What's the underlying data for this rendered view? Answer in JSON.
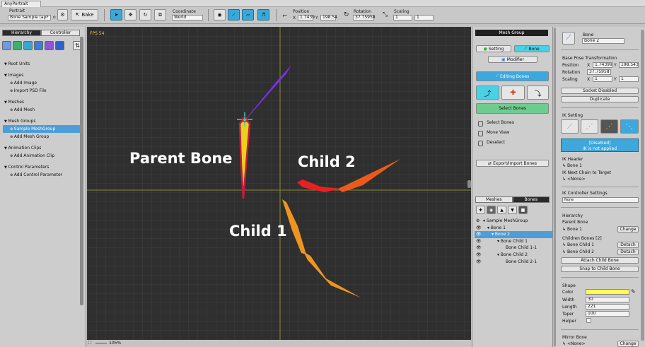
{
  "window": {
    "tab_title": "AnyPortrait"
  },
  "toolbar": {
    "portrait_label": "Portrait",
    "portrait_value": "Bone Sample (apF",
    "bake_label": "Bake",
    "coordinate_label": "Coordinate",
    "coordinate_value": "World",
    "position_label": "Position",
    "position_x": "1.7439",
    "position_y": "198.54",
    "rotation_label": "Rotation",
    "rotation_value": "37.75958",
    "scaling_label": "Scaling",
    "scaling_x": "1",
    "scaling_y": "1",
    "x_label": "X",
    "y_label": "Y"
  },
  "left_panel": {
    "tab_hierarchy": "Hierarchy",
    "tab_controller": "Controller",
    "sections": [
      {
        "header": "Root Units",
        "items": []
      },
      {
        "header": "Images",
        "items": [
          "Add Image",
          "Import PSD File"
        ]
      },
      {
        "header": "Meshes",
        "items": [
          "Add Mesh"
        ]
      },
      {
        "header": "Mesh Groups",
        "items": [
          "Sample MeshGroup",
          "Add Mesh Group"
        ]
      },
      {
        "header": "Animation Clips",
        "items": [
          "Add Animation Clip"
        ]
      },
      {
        "header": "Control Parameters",
        "items": [
          "Add Control Parameter"
        ]
      }
    ],
    "selected_item": "Sample MeshGroup"
  },
  "viewport": {
    "fps": "FPS 54",
    "zoom": "105%",
    "labels": {
      "parent_bone": "Parent Bone",
      "child_1": "Child 1",
      "child_2": "Child 2"
    },
    "colors": {
      "parent": "#e8d21a",
      "parent_outline": "#c81c3c",
      "purple": "#7b2ff0",
      "red": "#e82020",
      "orange_red": "#ea5a1c",
      "orange": "#ee9420"
    }
  },
  "mid_panel": {
    "header": "Mesh Group",
    "setting_btn": "Setting",
    "bone_btn": "Bone",
    "modifier_btn": "Modifier",
    "editing_bones_btn": "Editing Bones",
    "select_bones_btn": "Select Bones",
    "hints": [
      "Select Bones",
      "Move View",
      "Deselect"
    ],
    "export_btn": "Export/Import Bones",
    "tab_meshes": "Meshes",
    "tab_bones": "Bones",
    "bone_tree": [
      {
        "label": "Sample MeshGroup",
        "indent": 0
      },
      {
        "label": "Bone 1",
        "indent": 1
      },
      {
        "label": "Bone 2",
        "indent": 2
      },
      {
        "label": "Bone Child 1",
        "indent": 3
      },
      {
        "label": "Bone Child 1-1",
        "indent": 4
      },
      {
        "label": "Bone Child 2",
        "indent": 3
      },
      {
        "label": "Bone Child 2-1",
        "indent": 4
      }
    ],
    "selected_bone": "Bone 2"
  },
  "right_panel": {
    "bone_label": "Bone",
    "bone_name": "Bone 2",
    "base_pose_title": "Base Pose Transformation",
    "position_label": "Position",
    "pos_x": "1.74399",
    "pos_y": "198.543",
    "rotation_label": "Rotation",
    "rotation_value": "37.75958",
    "scaling_label": "Scaling",
    "scale_x": "1",
    "scale_y": "1",
    "x_label": "X",
    "y_label": "Y",
    "socket_btn": "Socket Disabled",
    "duplicate_btn": "Duplicate",
    "ik_setting_title": "IK Setting",
    "ik_status_line1": "[Disabled]",
    "ik_status_line2": "IK is not applied",
    "ik_header_label": "IK Header",
    "ik_header_value": "Bone 1",
    "ik_next_label": "IK Next Chain to Target",
    "ik_next_value": "<None>",
    "ik_controller_label": "IK Controller Settings",
    "ik_controller_value": "None",
    "hierarchy_title": "Hierarchy",
    "parent_bone_label": "Parent Bone",
    "parent_bone_value": "Bone 1",
    "change_btn": "Change",
    "children_label": "Children Bones [2]",
    "child1": "Bone Child 1",
    "child2": "Bone Child 2",
    "detach_btn": "Detach",
    "attach_btn": "Attach Child Bone",
    "snap_btn": "Snap to Child Bone",
    "shape_title": "Shape",
    "color_label": "Color",
    "color_value": "#ffff55",
    "width_label": "Width",
    "width_value": "30",
    "length_label": "Length",
    "length_value": "221",
    "taper_label": "Taper",
    "taper_value": "100",
    "helper_label": "Helper",
    "mirror_title": "Mirror Bone",
    "mirror_value": "<None>",
    "mirror_change_btn": "Change"
  }
}
